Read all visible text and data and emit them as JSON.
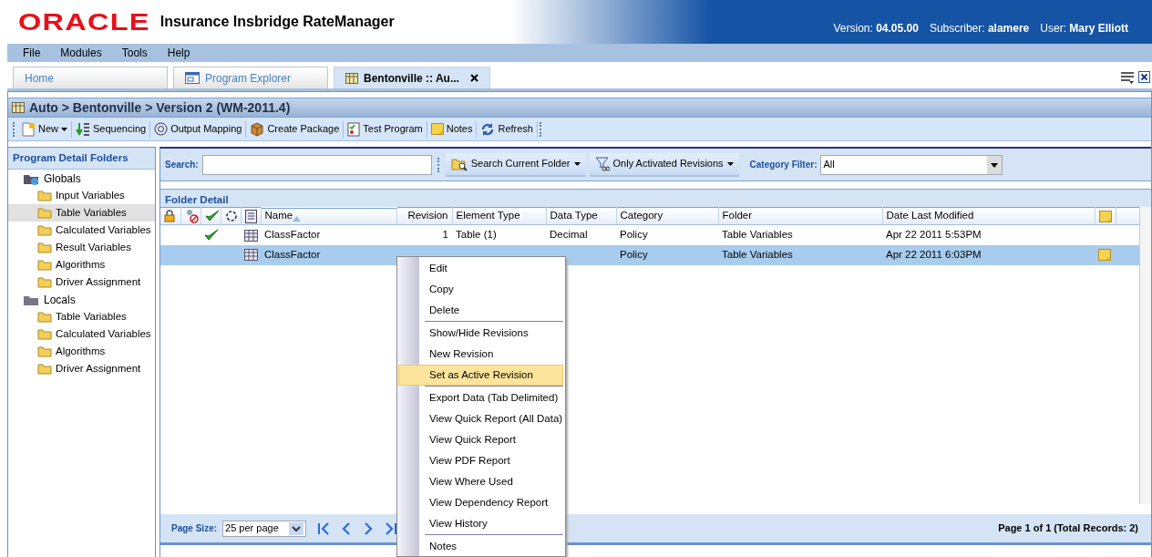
{
  "app": {
    "logo": "ORACLE",
    "title": "Insurance Insbridge RateManager",
    "info": [
      {
        "label": "Version:",
        "value": "04.05.00"
      },
      {
        "label": "Subscriber:",
        "value": "alamere"
      },
      {
        "label": "User:",
        "value": "Mary Elliott"
      }
    ]
  },
  "menu_bar": [
    "File",
    "Modules",
    "Tools",
    "Help"
  ],
  "tabs": [
    {
      "label": "Home",
      "selected": false
    },
    {
      "label": "Program Explorer",
      "selected": false
    },
    {
      "label": "Bentonville :: Au...",
      "selected": true
    }
  ],
  "breadcrumb": "Auto > Bentonville > Version 2 (WM-2011.4)",
  "toolbar": [
    {
      "label": "New",
      "dropdown": true
    },
    {
      "label": "Sequencing",
      "dropdown": false
    },
    {
      "label": "Output Mapping",
      "dropdown": false
    },
    {
      "label": "Create Package",
      "dropdown": false
    },
    {
      "label": "Test Program",
      "dropdown": false
    },
    {
      "label": "Notes",
      "dropdown": false
    },
    {
      "label": "Refresh",
      "dropdown": false
    }
  ],
  "sidebar": {
    "title": "Program Detail Folders",
    "items": [
      {
        "label": "Globals",
        "selected": false,
        "children": [
          {
            "label": "Input Variables",
            "selected": false
          },
          {
            "label": "Table Variables",
            "selected": true
          },
          {
            "label": "Calculated Variables",
            "selected": false
          },
          {
            "label": "Result Variables",
            "selected": false
          },
          {
            "label": "Algorithms",
            "selected": false
          },
          {
            "label": "Driver Assignment",
            "selected": false
          }
        ]
      },
      {
        "label": "Locals",
        "selected": false,
        "children": [
          {
            "label": "Table Variables",
            "selected": false
          },
          {
            "label": "Calculated Variables",
            "selected": false
          },
          {
            "label": "Algorithms",
            "selected": false
          },
          {
            "label": "Driver Assignment",
            "selected": false
          }
        ]
      }
    ]
  },
  "search": {
    "label": "Search:",
    "buttons": [
      {
        "label": "Search Current Folder"
      },
      {
        "label": "Only Activated Revisions"
      }
    ],
    "category_filter": {
      "label": "Category Filter:",
      "value": "All"
    }
  },
  "folder_detail": {
    "title": "Folder Detail",
    "columns": [
      "Name",
      "Revision",
      "Element Type",
      "Data Type",
      "Category",
      "Folder",
      "Date Last Modified"
    ],
    "rows": [
      {
        "selected": false,
        "active": true,
        "has_note": false,
        "name": "ClassFactor",
        "revision": "1",
        "element_type": "Table (1)",
        "data_type": "Decimal",
        "category": "Policy",
        "folder": "Table Variables",
        "date_last_modified": "Apr 22 2011 5:53PM"
      },
      {
        "selected": true,
        "active": false,
        "has_note": true,
        "name": "ClassFactor",
        "category": "Policy",
        "folder": "Table Variables",
        "date_last_modified": "Apr 22 2011 6:03PM"
      }
    ]
  },
  "pager": {
    "label": "Page Size:",
    "value": "25 per page",
    "summary": "Page 1 of 1 (Total Records: 2)"
  },
  "context_menu": {
    "items": [
      {
        "label": "Edit",
        "selected": false,
        "separator_before": false
      },
      {
        "label": "Copy",
        "selected": false,
        "separator_before": false
      },
      {
        "label": "Delete",
        "selected": false,
        "separator_before": false
      },
      {
        "label": "Show/Hide Revisions",
        "selected": false,
        "separator_before": true
      },
      {
        "label": "New Revision",
        "selected": false,
        "separator_before": false
      },
      {
        "label": "Set as Active Revision",
        "selected": true,
        "separator_before": false
      },
      {
        "label": "Export Data (Tab Delimited)",
        "selected": false,
        "separator_before": true
      },
      {
        "label": "View Quick Report (All Data)",
        "selected": false,
        "separator_before": false
      },
      {
        "label": "View Quick Report",
        "selected": false,
        "separator_before": false
      },
      {
        "label": "View PDF Report",
        "selected": false,
        "separator_before": false
      },
      {
        "label": "View Where Used",
        "selected": false,
        "separator_before": false
      },
      {
        "label": "View Dependency Report",
        "selected": false,
        "separator_before": false
      },
      {
        "label": "View History",
        "selected": false,
        "separator_before": false
      },
      {
        "label": "Notes",
        "selected": false,
        "separator_before": true
      }
    ]
  }
}
